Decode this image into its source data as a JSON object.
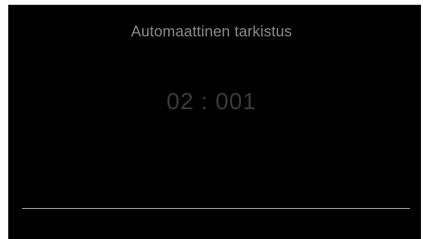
{
  "screen": {
    "title": "Automaattinen tarkistus",
    "channel_readout": "02 : 001",
    "colors": {
      "background": "#000000",
      "title_text": "#8a8a8a",
      "readout_text": "#3a3a3a",
      "line": "#d6d6d6"
    }
  }
}
